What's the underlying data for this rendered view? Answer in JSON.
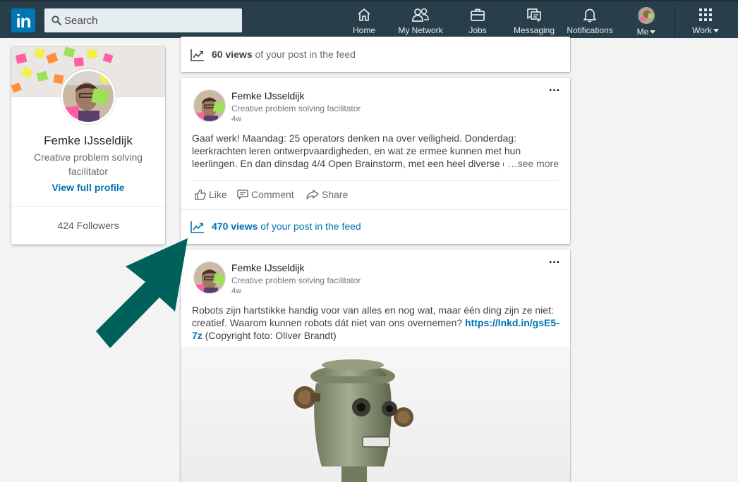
{
  "brand": {
    "logo_text": "in",
    "logo_color": "#0077b5"
  },
  "search": {
    "placeholder": "Search"
  },
  "nav": {
    "home": "Home",
    "network": "My Network",
    "jobs": "Jobs",
    "messaging": "Messaging",
    "notifications": "Notifications",
    "me": "Me",
    "work": "Work"
  },
  "profile": {
    "name": "Femke IJsseldijk",
    "title": "Creative problem solving facilitator",
    "view_link": "View full profile",
    "followers": "424 Followers"
  },
  "feed": {
    "first_views": {
      "count": "60 views",
      "suffix": " of your post in the feed"
    },
    "post1": {
      "author": "Femke IJsseldijk",
      "subtitle": "Creative problem solving facilitator",
      "time": "4w",
      "text": "Gaaf werk! Maandag: 25 operators denken na over veiligheid. Donderdag: leerkrachten leren ontwerpvaardigheden, en wat ze ermee kunnen met hun leerlingen. En dan dinsdag 4/4 Open Brainstorm, met een heel diverse groep",
      "see_more": "…see more",
      "like": "Like",
      "comment": "Comment",
      "share": "Share",
      "views_count": "470 views",
      "views_suffix": " of your post in the feed"
    },
    "post2": {
      "author": "Femke IJsseldijk",
      "subtitle": "Creative problem solving facilitator",
      "time": "4w",
      "text_before": "Robots zijn hartstikke handig voor van alles en nog wat, maar één ding zijn ze niet: creatief. Waarom kunnen robots dát niet van ons overnemen? ",
      "link": "https://lnkd.in/gsE5-7z",
      "text_after": " (Copyright foto: Oliver Brandt)"
    }
  },
  "colors": {
    "nav_bg": "#283e4a",
    "link_blue": "#0073b1",
    "arrow": "#00605a"
  },
  "icons": [
    "search-icon",
    "home-icon",
    "network-icon",
    "jobs-icon",
    "messaging-icon",
    "notifications-icon",
    "grid-icon",
    "chart-icon",
    "like-icon",
    "comment-icon",
    "share-icon",
    "more-icon"
  ]
}
